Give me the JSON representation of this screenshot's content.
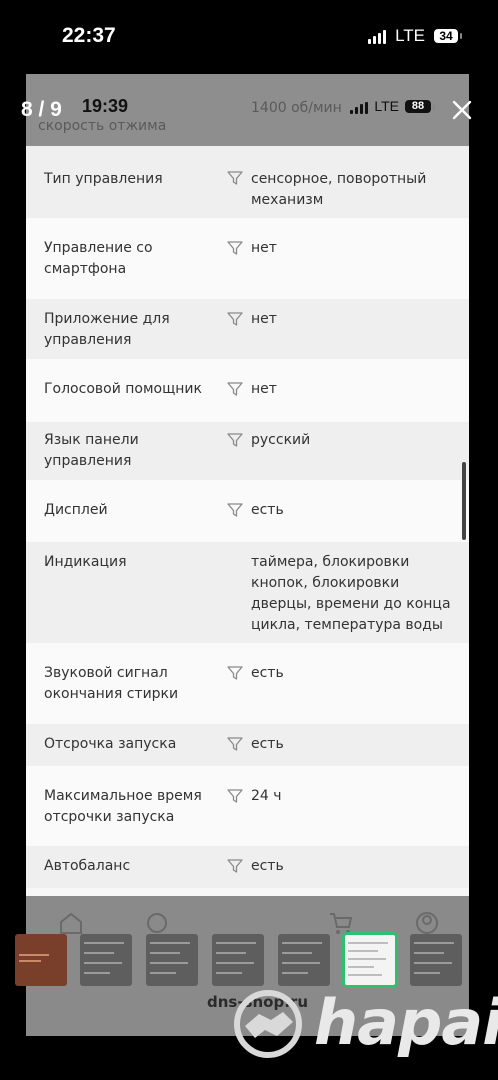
{
  "status_bar": {
    "time": "22:37",
    "network": "LTE",
    "battery": "34"
  },
  "viewer": {
    "counter": "8 / 9"
  },
  "screenshot": {
    "status_bar": {
      "time": "19:39",
      "network": "LTE",
      "battery": "88"
    },
    "partial_top": {
      "label_fragment": "скорость отжима",
      "value_fragment": "1400 об/мин"
    },
    "specs": [
      {
        "label": "Тип управления",
        "value": "сенсорное, поворотный механизм",
        "filter": true
      },
      {
        "label": "Управление со смартфона",
        "value": "нет",
        "filter": true
      },
      {
        "label": "Приложение для управления",
        "value": "нет",
        "filter": true
      },
      {
        "label": "Голосовой помощник",
        "value": "нет",
        "filter": true
      },
      {
        "label": "Язык панели управления",
        "value": "русский",
        "filter": true
      },
      {
        "label": "Дисплей",
        "value": "есть",
        "filter": true
      },
      {
        "label": "Индикация",
        "value": "таймера, блокировки кнопок, блокировки дверцы, времени до конца цикла, температура воды",
        "filter": false
      },
      {
        "label": "Звуковой сигнал окончания стирки",
        "value": "есть",
        "filter": true
      },
      {
        "label": "Отсрочка запуска",
        "value": "есть",
        "filter": true
      },
      {
        "label": "Максимальное время отсрочки запуска",
        "value": "24 ч",
        "filter": true
      },
      {
        "label": "Автобаланс",
        "value": "есть",
        "filter": true
      }
    ],
    "bottom_domain": "dns-shop.ru"
  },
  "watermark": {
    "text": "hapai"
  },
  "thumbnails": {
    "count": 7,
    "selected_index": 5
  },
  "colors": {
    "selected_thumb_border": "#2fbf6e",
    "row_alt": "#efefef",
    "row_white": "#fafafa"
  }
}
